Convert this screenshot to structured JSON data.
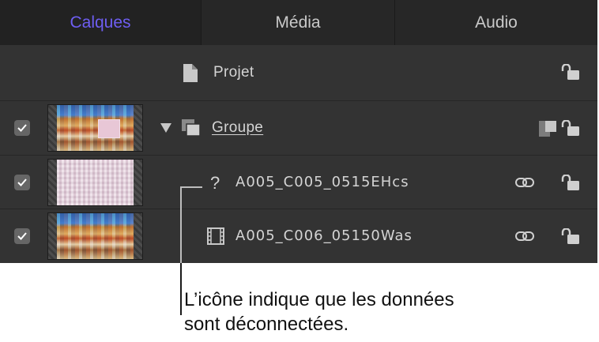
{
  "tabs": [
    {
      "label": "Calques",
      "active": true
    },
    {
      "label": "Média",
      "active": false
    },
    {
      "label": "Audio",
      "active": false
    }
  ],
  "colors": {
    "active_tab_text": "#6e5ef2",
    "tab_text": "#c9c9c9",
    "panel_bg": "#333333",
    "text": "#d4d4d4"
  },
  "layers": {
    "project": {
      "label": "Projet",
      "icon": "document-icon",
      "lock_icon": "unlock-icon"
    },
    "group": {
      "label": "Groupe",
      "checked": true,
      "disclosure": "triangle-down-icon",
      "icon": "group-icon",
      "extra_icon": "isolate-icon",
      "lock_icon": "unlock-icon"
    },
    "clip1": {
      "label": "A005_C005_0515EHcs",
      "checked": true,
      "status_icon": "question-mark-icon",
      "status_glyph": "?",
      "link_icon": "link-icon",
      "lock_icon": "unlock-icon"
    },
    "clip2": {
      "label": "A005_C006_05150Was",
      "checked": true,
      "icon": "film-strip-icon",
      "link_icon": "link-icon",
      "lock_icon": "unlock-icon"
    }
  },
  "callout": {
    "text_line1": "L’icône indique que les données",
    "text_line2": "sont déconnectées."
  }
}
